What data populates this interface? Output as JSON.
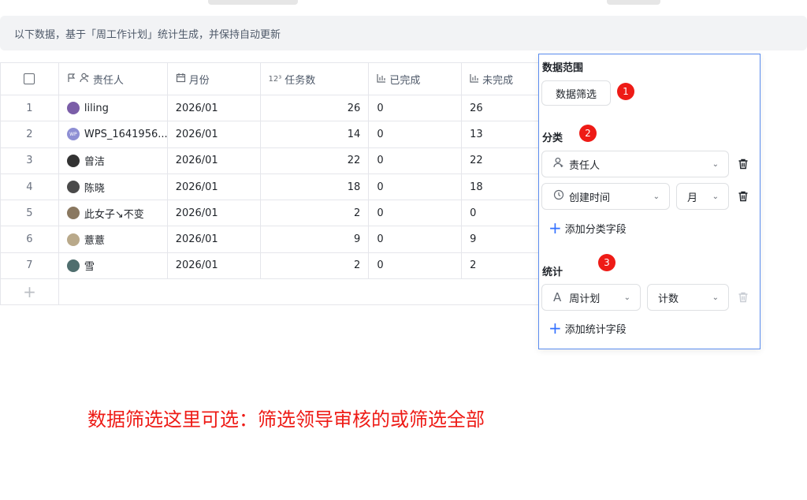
{
  "info_bar": {
    "text": "以下数据，基于「周工作计划」统计生成，并保持自动更新"
  },
  "table": {
    "columns": [
      {
        "label": "责任人",
        "icon": "person-icon"
      },
      {
        "label": "月份",
        "icon": "calendar-icon"
      },
      {
        "label": "任务数",
        "icon": "number-icon"
      },
      {
        "label": "已完成",
        "icon": "bar-chart-icon"
      },
      {
        "label": "未完成",
        "icon": "bar-chart-icon"
      }
    ],
    "rows": [
      {
        "index": "1",
        "owner": "liling",
        "avatar_initials": "",
        "avatar_color": "#7b5ea8",
        "month": "2026/01",
        "tasks": "26",
        "done": "0",
        "undone": "26"
      },
      {
        "index": "2",
        "owner": "WPS_1641956...",
        "avatar_initials": "WP",
        "avatar_color": "#8e8fd4",
        "month": "2026/01",
        "tasks": "14",
        "done": "0",
        "undone": "13"
      },
      {
        "index": "3",
        "owner": "曾洁",
        "avatar_initials": "",
        "avatar_color": "#333333",
        "month": "2026/01",
        "tasks": "22",
        "done": "0",
        "undone": "22"
      },
      {
        "index": "4",
        "owner": "陈晓",
        "avatar_initials": "",
        "avatar_color": "#4a4a4a",
        "month": "2026/01",
        "tasks": "18",
        "done": "0",
        "undone": "18"
      },
      {
        "index": "5",
        "owner": "此女子↘不变",
        "avatar_initials": "",
        "avatar_color": "#8a7860",
        "month": "2026/01",
        "tasks": "2",
        "done": "0",
        "undone": "0"
      },
      {
        "index": "6",
        "owner": "薏薏",
        "avatar_initials": "",
        "avatar_color": "#b9a98a",
        "month": "2026/01",
        "tasks": "9",
        "done": "0",
        "undone": "9"
      },
      {
        "index": "7",
        "owner": "雪",
        "avatar_initials": "",
        "avatar_color": "#4f6e6e",
        "month": "2026/01",
        "tasks": "2",
        "done": "0",
        "undone": "2"
      }
    ],
    "add_row_symbol": "+"
  },
  "panel": {
    "data_range": {
      "title": "数据范围",
      "filter_button": "数据筛选",
      "badge": "1"
    },
    "category": {
      "title": "分类",
      "badge": "2",
      "field1": "责任人",
      "field2": "创建时间",
      "field2_unit": "月",
      "add_label": "添加分类字段"
    },
    "stats": {
      "title": "统计",
      "badge": "3",
      "field": "周计划",
      "method": "计数",
      "add_label": "添加统计字段"
    }
  },
  "annotation": "数据筛选这里可选：筛选领导审核的或筛选全部",
  "colors": {
    "accent": "#3370ff",
    "badge": "#ee1b16",
    "panel_border": "#5b8def"
  }
}
